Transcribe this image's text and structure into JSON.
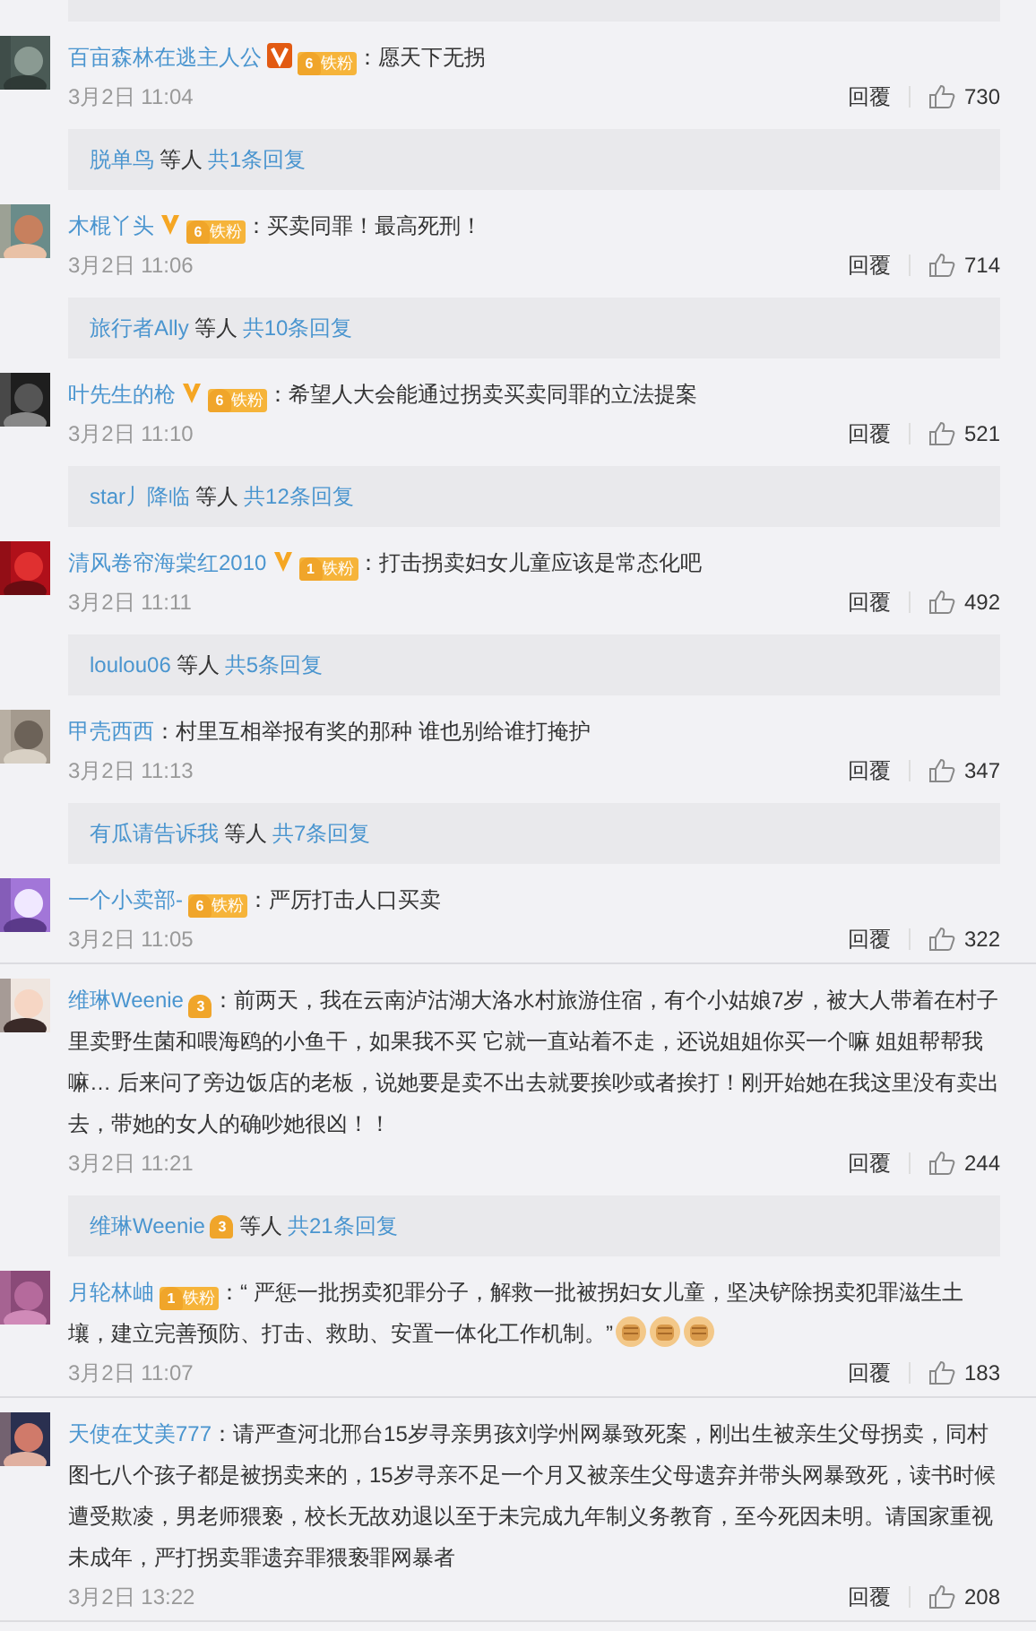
{
  "comments": [
    {
      "user": "百亩森林在逃主人公",
      "verified": {
        "kind": "box"
      },
      "fan": {
        "level": "6",
        "label": "铁粉"
      },
      "text": "：愿天下无拐",
      "time": "3月2日 11:04",
      "reply_label": "回覆",
      "likes": "730",
      "replies": {
        "user": "脱单鸟",
        "suffix": "等人",
        "count": "共1条回复"
      }
    },
    {
      "user": "木棍丫头",
      "verified": {
        "kind": "plain"
      },
      "fan": {
        "level": "6",
        "label": "铁粉"
      },
      "text": "：买卖同罪！最高死刑！",
      "time": "3月2日 11:06",
      "reply_label": "回覆",
      "likes": "714",
      "replies": {
        "user": "旅行者Ally",
        "suffix": "等人",
        "count": "共10条回复"
      }
    },
    {
      "user": "叶先生的枪",
      "verified": {
        "kind": "plain"
      },
      "fan": {
        "level": "6",
        "label": "铁粉"
      },
      "text": "：希望人大会能通过拐卖买卖同罪的立法提案",
      "time": "3月2日 11:10",
      "reply_label": "回覆",
      "likes": "521",
      "replies": {
        "user": "star丿降临",
        "suffix": "等人",
        "count": "共12条回复"
      }
    },
    {
      "user": "清风卷帘海棠红2010",
      "verified": {
        "kind": "plain"
      },
      "fan": {
        "level": "1",
        "label": "铁粉"
      },
      "text": "：打击拐卖妇女儿童应该是常态化吧",
      "time": "3月2日 11:11",
      "reply_label": "回覆",
      "likes": "492",
      "replies": {
        "user": "loulou06",
        "suffix": "等人",
        "count": "共5条回复"
      }
    },
    {
      "user": "甲壳西西",
      "text": "：村里互相举报有奖的那种 谁也别给谁打掩护",
      "time": "3月2日 11:13",
      "reply_label": "回覆",
      "likes": "347",
      "replies": {
        "user": "有瓜请告诉我",
        "suffix": "等人",
        "count": "共7条回复"
      }
    },
    {
      "user": "一个小卖部-",
      "fan": {
        "level": "6",
        "label": "铁粉"
      },
      "text": "：严厉打击人口买卖",
      "time": "3月2日 11:05",
      "reply_label": "回覆",
      "likes": "322"
    },
    {
      "user": "维琳Weenie",
      "fan": {
        "level": "3"
      },
      "text": "：前两天，我在云南泸沽湖大洛水村旅游住宿，有个小姑娘7岁，被大人带着在村子里卖野生菌和喂海鸥的小鱼干，如果我不买 它就一直站着不走，还说姐姐你买一个嘛 姐姐帮帮我嘛… 后来问了旁边饭店的老板，说她要是卖不出去就要挨吵或者挨打！刚开始她在我这里没有卖出去，带她的女人的确吵她很凶！！",
      "time": "3月2日 11:21",
      "reply_label": "回覆",
      "likes": "244",
      "replies": {
        "user": "维琳Weenie",
        "user_fan": {
          "level": "3"
        },
        "suffix": "等人",
        "count": "共21条回复"
      }
    },
    {
      "user": "月轮林岫",
      "fan": {
        "level": "1",
        "label": "铁粉"
      },
      "text": "：“ 严惩一批拐卖犯罪分子，解救一批被拐妇女儿童，坚决铲除拐卖犯罪滋生土壤，建立完善预防、打击、救助、安置一体化工作机制。”",
      "emojis": [
        {
          "kind": "fist"
        },
        {
          "kind": "fist"
        },
        {
          "kind": "fist"
        }
      ],
      "time": "3月2日 11:07",
      "reply_label": "回覆",
      "likes": "183"
    },
    {
      "user": "天使在艾美777",
      "text": "：请严查河北邢台15岁寻亲男孩刘学州网暴致死案，刚出生被亲生父母拐卖，同村图七八个孩子都是被拐卖来的，15岁寻亲不足一个月又被亲生父母遗弃并带头网暴致死，读书时候遭受欺凌，男老师猥亵，校长无故劝退以至于未完成九年制义务教育，至今死因未明。请国家重视未成年，严打拐卖罪遗弃罪猥亵罪网暴者",
      "time": "3月2日 13:22",
      "reply_label": "回覆",
      "likes": "208"
    }
  ]
}
